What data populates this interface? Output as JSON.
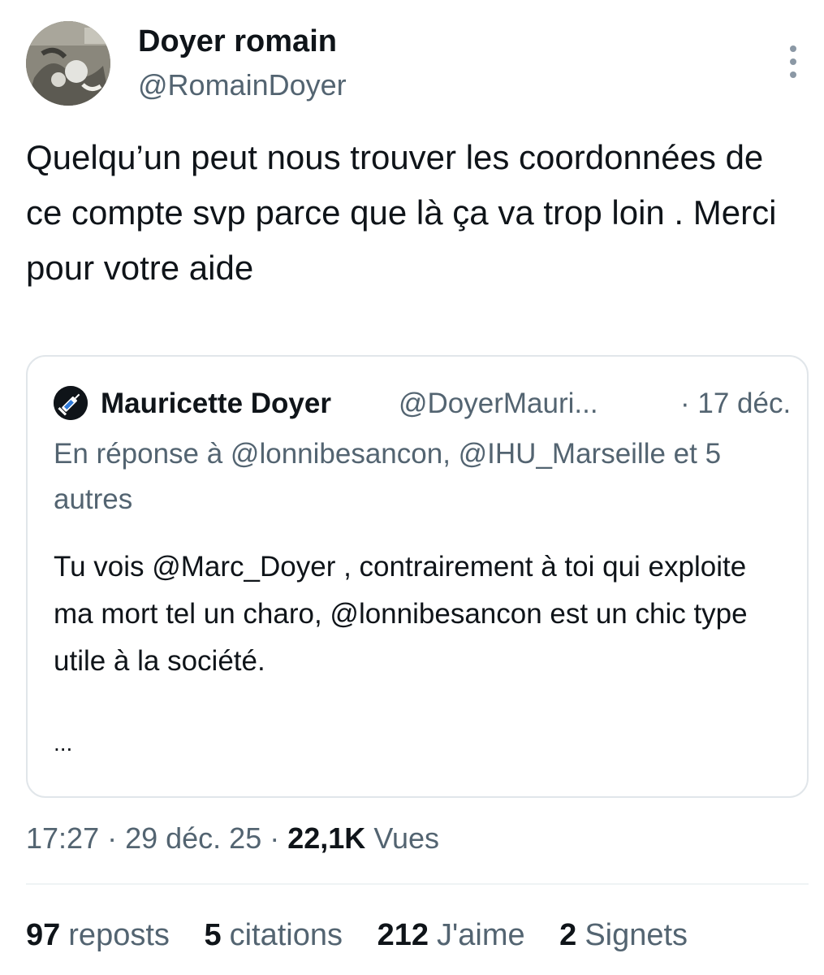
{
  "author": {
    "name": "Doyer romain",
    "handle": "@RomainDoyer"
  },
  "tweet": {
    "text": "Quelqu’un peut nous trouver les coordonnées de ce compte svp parce que là ça va trop loin . Merci pour votre aide"
  },
  "quote": {
    "name": "Mauricette Doyer",
    "handle": "@DoyerMauri...",
    "date": "· 17 déc.",
    "reply_context": "En réponse à @lonnibesancon, @IHU_Marseille et 5 autres",
    "text": "Tu vois @Marc_Doyer , contrairement à toi qui exploite ma mort tel un charo, @lonnibesancon est un chic type utile à la société.",
    "ellipsis": "..."
  },
  "meta": {
    "time": "17:27",
    "sep1": " · ",
    "date": "29 déc. 25",
    "sep2": " · ",
    "views": "22,1K",
    "views_label": "Vues"
  },
  "stats": {
    "reposts_count": "97",
    "reposts_label": "reposts",
    "quotes_count": "5",
    "quotes_label": "citations",
    "likes_count": "212",
    "likes_label": "J'aime",
    "bookmarks_count": "2",
    "bookmarks_label": "Signets"
  },
  "icons": {
    "more": "more-vertical-icon",
    "quote_avatar": "syringe-icon"
  },
  "colors": {
    "text_primary": "#0f1419",
    "text_secondary": "#536471",
    "border": "#e1e6ea"
  }
}
